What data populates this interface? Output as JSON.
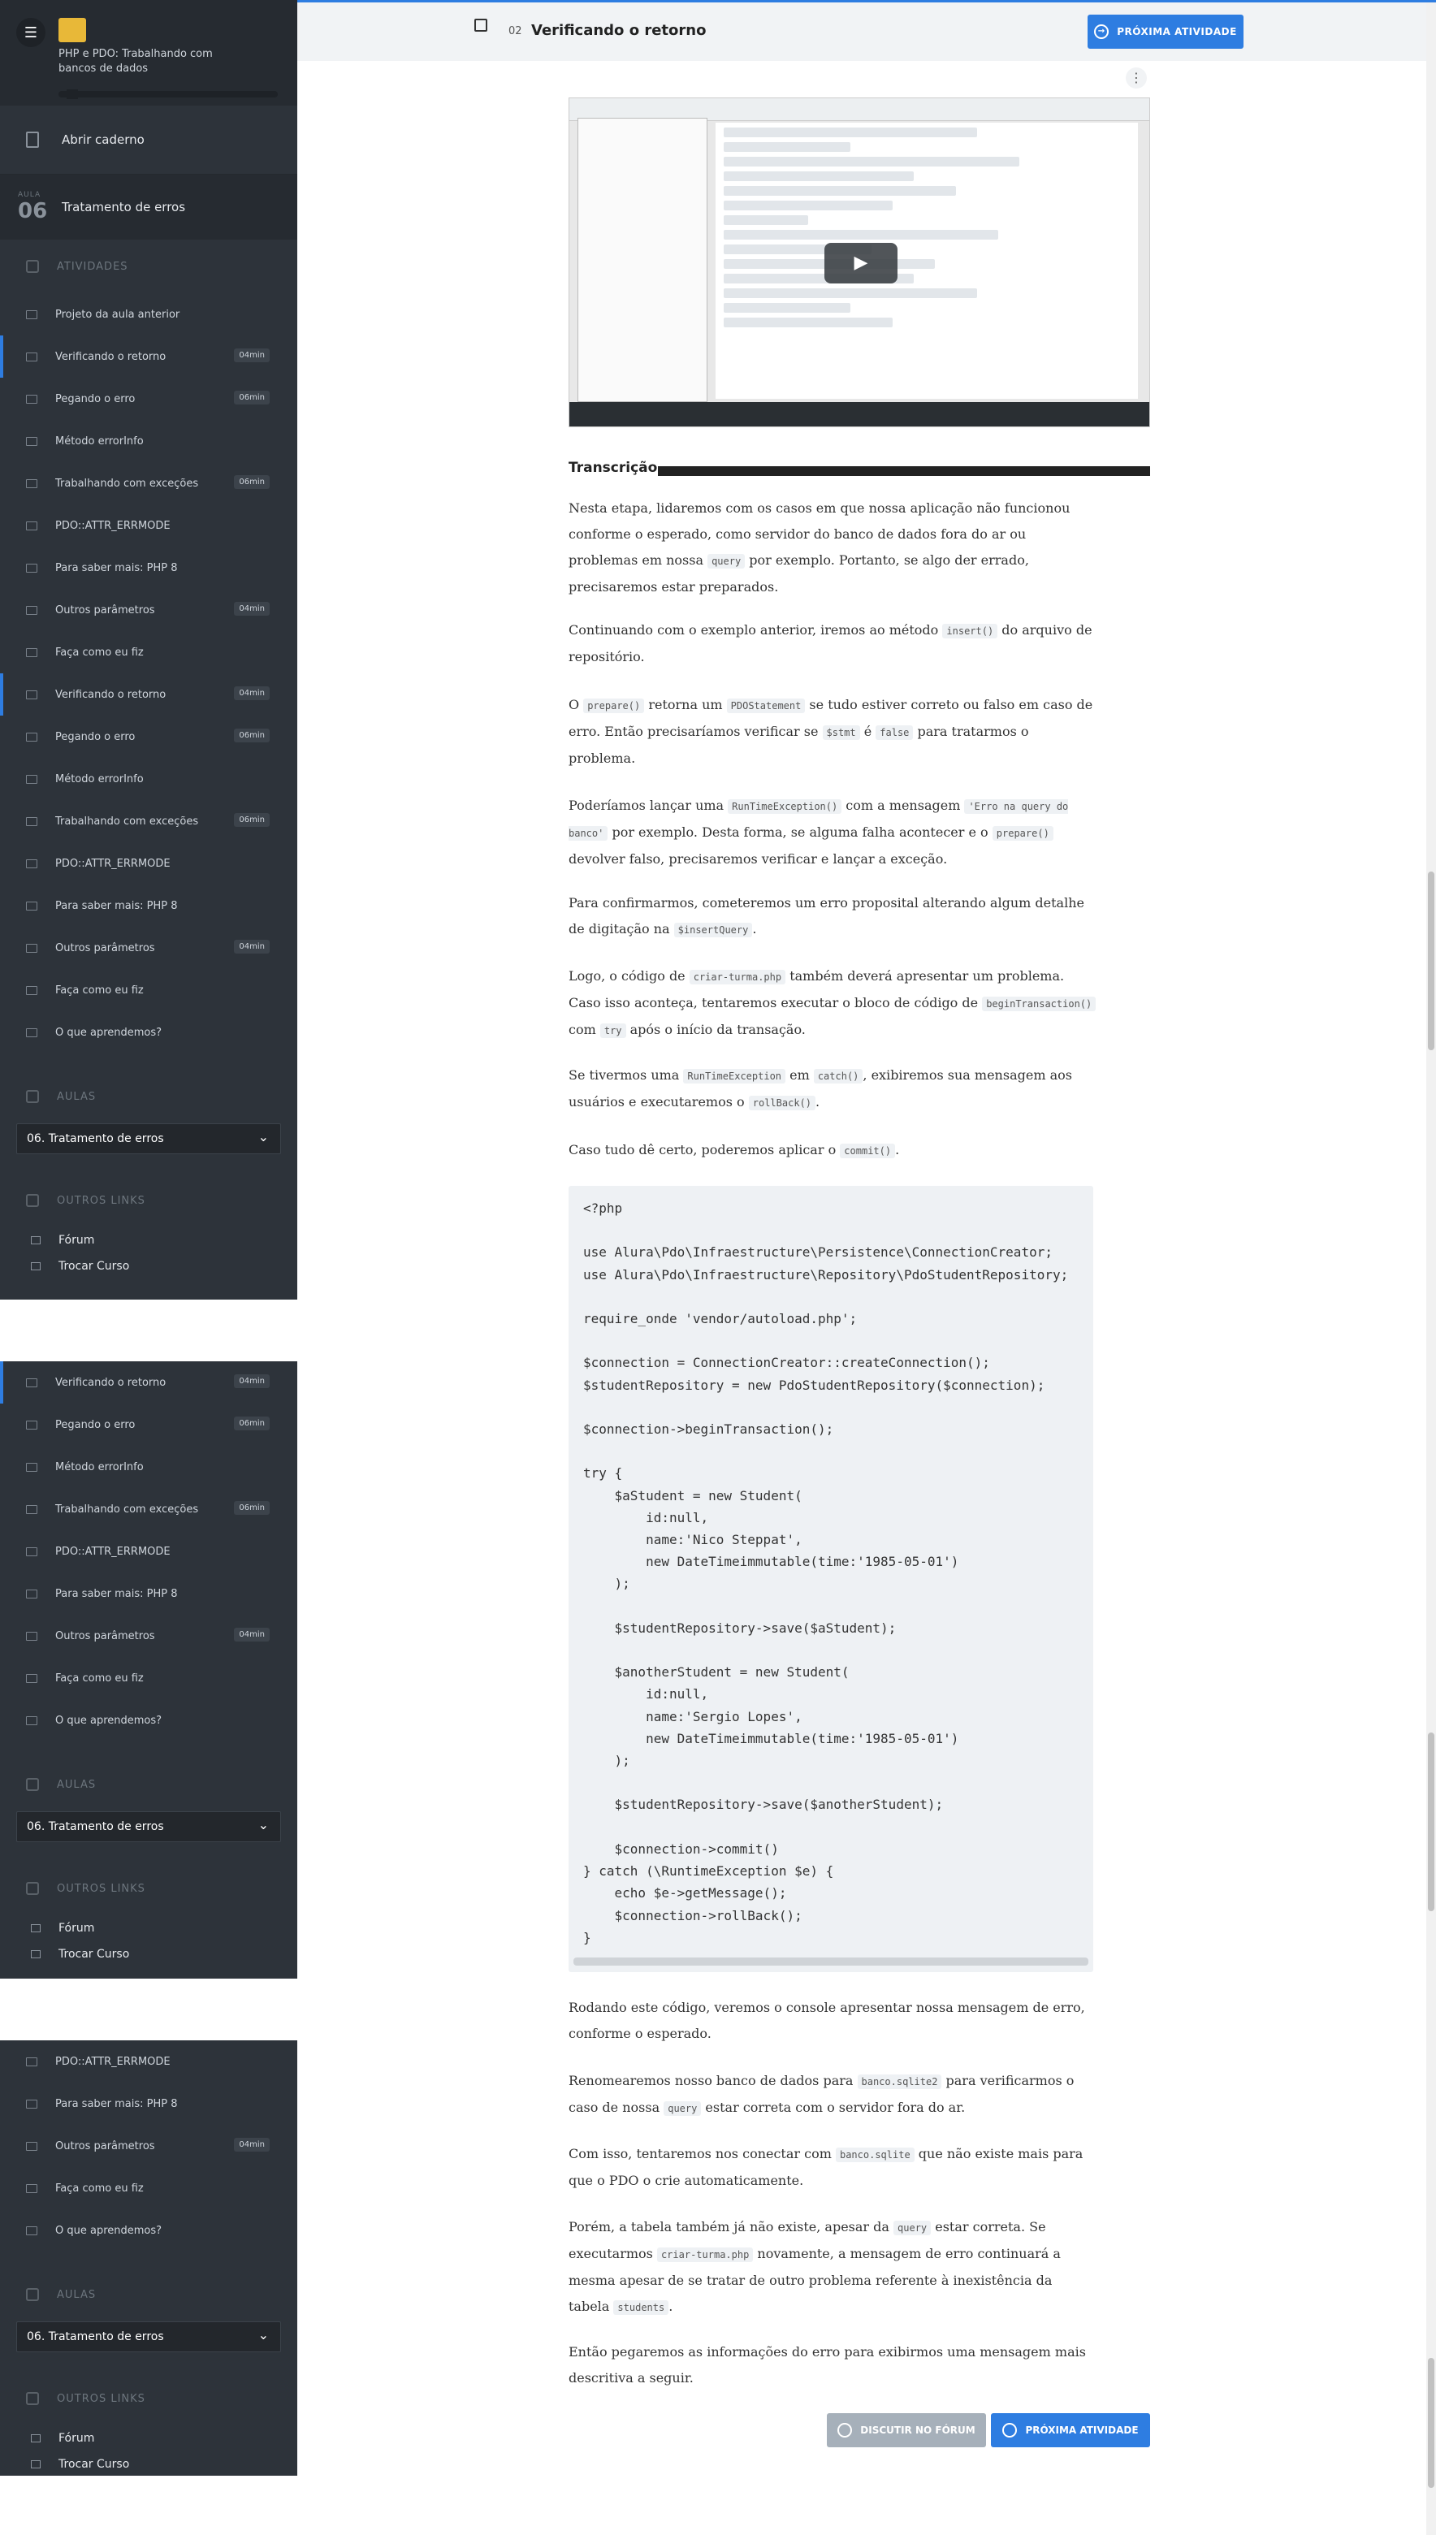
{
  "course": {
    "title": "PHP e PDO: Trabalhando com bancos de dados",
    "notebook": "Abrir caderno",
    "lesson_label": "AULA",
    "lesson_num": "06",
    "lesson_title": "Tratamento de erros"
  },
  "sections": {
    "activities": "ATIVIDADES",
    "classes": "AULAS",
    "links": "OUTROS LINKS"
  },
  "activities": [
    {
      "label": "Projeto da aula anterior",
      "dur": ""
    },
    {
      "label": "Verificando o retorno",
      "dur": "04min"
    },
    {
      "label": "Pegando o erro",
      "dur": "06min"
    },
    {
      "label": "Método errorInfo",
      "dur": ""
    },
    {
      "label": "Trabalhando com exceções",
      "dur": "06min"
    },
    {
      "label": "PDO::ATTR_ERRMODE",
      "dur": ""
    },
    {
      "label": "Para saber mais: PHP 8",
      "dur": ""
    },
    {
      "label": "Outros parâmetros",
      "dur": "04min"
    },
    {
      "label": "Faça como eu fiz",
      "dur": ""
    },
    {
      "label": "O que aprendemos?",
      "dur": ""
    }
  ],
  "class_select": "06. Tratamento de erros",
  "links": [
    "Fórum",
    "Trocar Curso"
  ],
  "topbar": {
    "num": "02",
    "title": "Verificando o retorno",
    "next": "PRÓXIMA ATIVIDADE"
  },
  "transcription_title": "Transcrição",
  "code_text": "<?php\n\nuse Alura\\Pdo\\Infraestructure\\Persistence\\ConnectionCreator;\nuse Alura\\Pdo\\Infraestructure\\Repository\\PdoStudentRepository;\n\nrequire_onde 'vendor/autoload.php';\n\n$connection = ConnectionCreator::createConnection();\n$studentRepository = new PdoStudentRepository($connection);\n\n$connection->beginTransaction();\n\ntry {\n    $aStudent = new Student(\n        id:null,\n        name:'Nico Steppat',\n        new DateTimeimmutable(time:'1985-05-01')\n    );\n\n    $studentRepository->save($aStudent);\n\n    $anotherStudent = new Student(\n        id:null,\n        name:'Sergio Lopes',\n        new DateTimeimmutable(time:'1985-05-01')\n    );\n\n    $studentRepository->save($anotherStudent);\n\n    $connection->commit()\n} catch (\\RuntimeException $e) {\n    echo $e->getMessage();\n    $connection->rollBack();\n}",
  "buttons": {
    "discuss": "DISCUTIR NO FÓRUM",
    "next": "PRÓXIMA ATIVIDADE"
  },
  "paras": {
    "p1a": "Nesta etapa, lidaremos com os casos em que nossa aplicação não funcionou conforme o esperado, como servidor do banco de dados fora do ar ou problemas em nossa ",
    "p1c": "query",
    "p1b": " por exemplo. Portanto, se algo der errado, precisaremos estar preparados.",
    "p2a": "Continuando com o exemplo anterior, iremos ao método ",
    "p2c": "insert()",
    "p2b": " do arquivo de repositório.",
    "p3a": "O ",
    "p3c1": "prepare()",
    "p3b": " retorna um ",
    "p3c2": "PDOStatement",
    "p3d": " se tudo estiver correto ou falso em caso de erro. Então precisaríamos verificar se ",
    "p3c3": "$stmt",
    "p3e": " é ",
    "p3c4": "false",
    "p3f": " para tratarmos o problema.",
    "p4a": "Poderíamos lançar uma ",
    "p4c1": "RunTimeException()",
    "p4b": " com a mensagem ",
    "p4c2": "'Erro na query do banco'",
    "p4d": " por exemplo. Desta forma, se alguma falha acontecer e o ",
    "p4c3": "prepare()",
    "p4e": " devolver falso, precisaremos verificar e lançar a exceção.",
    "p5a": "Para confirmarmos, cometeremos um erro proposital alterando algum detalhe de digitação na ",
    "p5c": "$insertQuery",
    "p5b": ".",
    "p6a": "Logo, o código de ",
    "p6c1": "criar-turma.php",
    "p6b": " também deverá apresentar um problema. Caso isso aconteça, tentaremos executar o bloco de código de ",
    "p6c2": "beginTransaction()",
    "p6d": " com ",
    "p6c3": "try",
    "p6e": " após o início da transação.",
    "p7a": "Se tivermos uma ",
    "p7c1": "RunTimeException",
    "p7b": " em ",
    "p7c2": "catch()",
    "p7d": ", exibiremos sua mensagem aos usuários e executaremos o ",
    "p7c3": "rollBack()",
    "p7e": ".",
    "p8a": "Caso tudo dê certo, poderemos aplicar o ",
    "p8c": "commit()",
    "p8b": ".",
    "p9": "Rodando este código, veremos o console apresentar nossa mensagem de erro, conforme o esperado.",
    "p10a": "Renomearemos nosso banco de dados para ",
    "p10c1": "banco.sqlite2",
    "p10b": " para verificarmos o caso de nossa ",
    "p10c2": "query",
    "p10d": " estar correta com o servidor fora do ar.",
    "p11a": "Com isso, tentaremos nos conectar com ",
    "p11c": "banco.sqlite",
    "p11b": " que não existe mais para que o PDO o crie automaticamente.",
    "p12a": "Porém, a tabela também já não existe, apesar da ",
    "p12c1": "query",
    "p12b": " estar correta. Se executarmos ",
    "p12c2": "criar-turma.php",
    "p12d": " novamente, a mensagem de erro continuará a mesma apesar de se tratar de outro problema referente à inexistência da tabela ",
    "p12c3": "students",
    "p12e": ".",
    "p13": "Então pegaremos as informações do erro para exibirmos uma mensagem mais descritiva a seguir."
  }
}
